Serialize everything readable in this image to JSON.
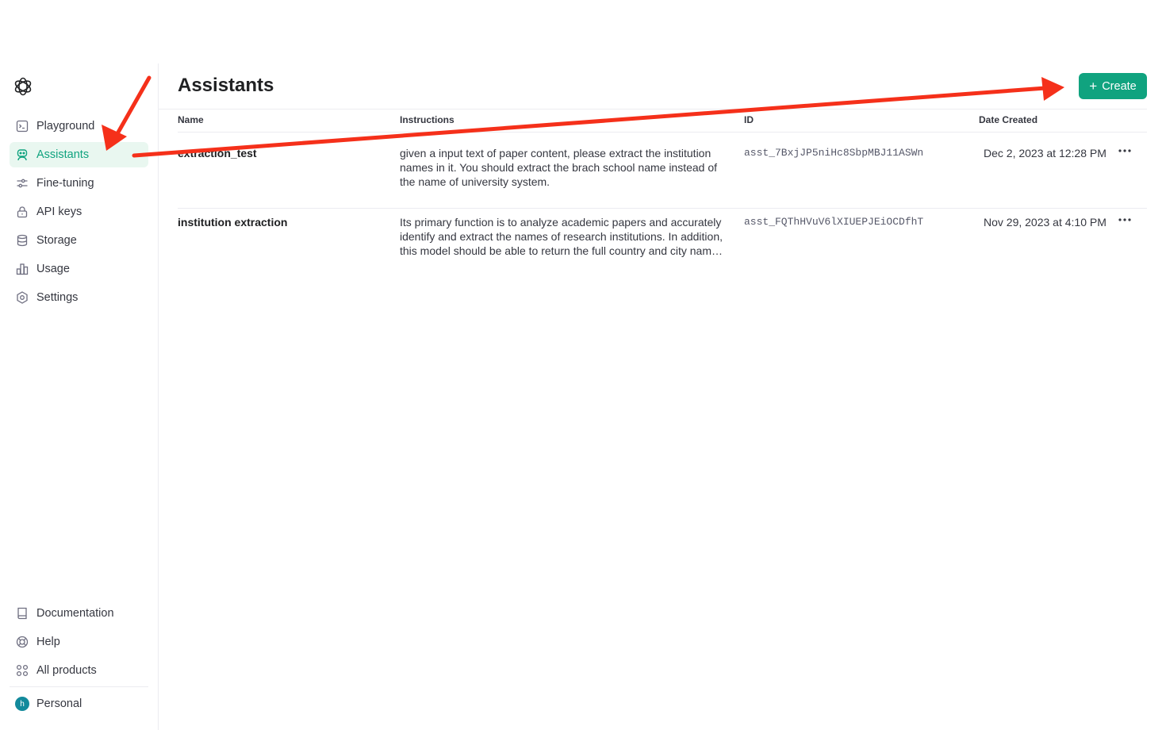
{
  "sidebar": {
    "nav": [
      {
        "label": "Playground",
        "icon": "terminal-icon"
      },
      {
        "label": "Assistants",
        "icon": "robot-icon",
        "active": true
      },
      {
        "label": "Fine-tuning",
        "icon": "sliders-icon"
      },
      {
        "label": "API keys",
        "icon": "lock-icon"
      },
      {
        "label": "Storage",
        "icon": "database-icon"
      },
      {
        "label": "Usage",
        "icon": "bar-chart-icon"
      },
      {
        "label": "Settings",
        "icon": "gear-icon"
      }
    ],
    "bottom": [
      {
        "label": "Documentation",
        "icon": "book-icon"
      },
      {
        "label": "Help",
        "icon": "lifebuoy-icon"
      },
      {
        "label": "All products",
        "icon": "grid-icon"
      }
    ],
    "account": {
      "label": "Personal",
      "initial": "h"
    }
  },
  "header": {
    "title": "Assistants",
    "create_label": "Create"
  },
  "table": {
    "columns": [
      "Name",
      "Instructions",
      "ID",
      "Date Created"
    ],
    "rows": [
      {
        "name": "extraction_test",
        "instructions": "given a input text of paper content, please extract the institution names in it. You should extract the brach school name instead of the name of university system.",
        "id": "asst_7BxjJP5niHc8SbpMBJ11ASWn",
        "date": "Dec 2, 2023 at 12:28 PM"
      },
      {
        "name": "institution extraction",
        "instructions": "Its primary function is to analyze academic papers and accurately identify and extract the names of research institutions. In addition, this model should be able to return the full country and city name …",
        "id": "asst_FQThHVuV6lXIUEPJEiOCDfhT",
        "date": "Nov 29, 2023 at 4:10 PM"
      }
    ]
  },
  "colors": {
    "accent": "#10a37f",
    "active_bg": "#e9f7f0",
    "annotation_arrow": "#f5301a"
  }
}
